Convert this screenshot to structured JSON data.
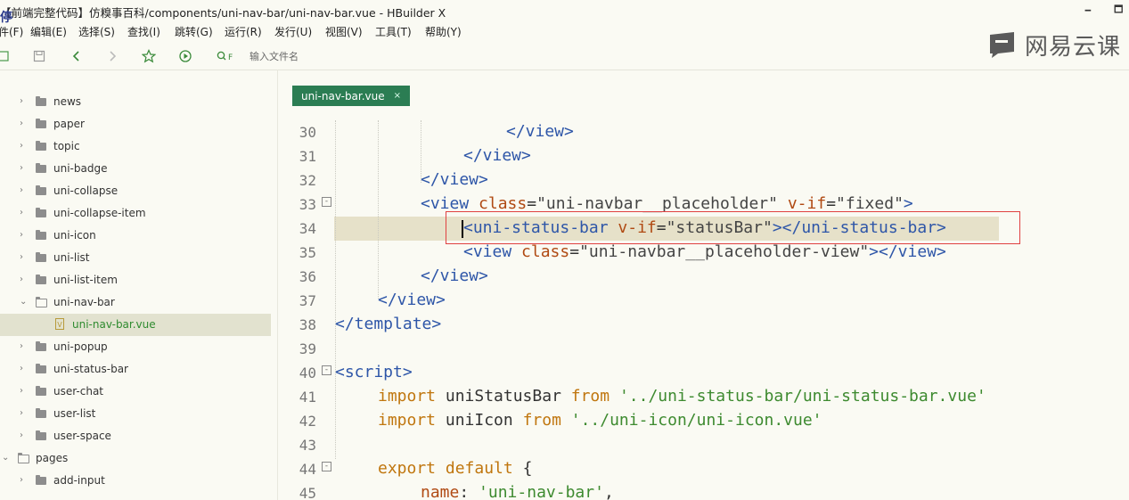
{
  "window": {
    "title": "【前端完整代码】仿糗事百科/components/uni-nav-bar/uni-nav-bar.vue - HBuilder X",
    "badge": "停",
    "minimize": "🗕",
    "maximize": "🗖"
  },
  "menu": [
    "件(F)",
    "编辑(E)",
    "选择(S)",
    "查找(I)",
    "跳转(G)",
    "运行(R)",
    "发行(U)",
    "视图(V)",
    "工具(T)",
    "帮助(Y)"
  ],
  "toolbar": {
    "search_placeholder": "输入文件名",
    "search_prefix": "Q F"
  },
  "watermark": {
    "text": "网易云课"
  },
  "sidebar": {
    "items": [
      {
        "label": "news",
        "type": "folder",
        "depth": 1,
        "expanded": false,
        "selected": false
      },
      {
        "label": "paper",
        "type": "folder",
        "depth": 1,
        "expanded": false,
        "selected": false
      },
      {
        "label": "topic",
        "type": "folder",
        "depth": 1,
        "expanded": false,
        "selected": false
      },
      {
        "label": "uni-badge",
        "type": "folder",
        "depth": 1,
        "expanded": false,
        "selected": false
      },
      {
        "label": "uni-collapse",
        "type": "folder",
        "depth": 1,
        "expanded": false,
        "selected": false
      },
      {
        "label": "uni-collapse-item",
        "type": "folder",
        "depth": 1,
        "expanded": false,
        "selected": false
      },
      {
        "label": "uni-icon",
        "type": "folder",
        "depth": 1,
        "expanded": false,
        "selected": false
      },
      {
        "label": "uni-list",
        "type": "folder",
        "depth": 1,
        "expanded": false,
        "selected": false
      },
      {
        "label": "uni-list-item",
        "type": "folder",
        "depth": 1,
        "expanded": false,
        "selected": false
      },
      {
        "label": "uni-nav-bar",
        "type": "folder",
        "depth": 1,
        "expanded": true,
        "selected": false
      },
      {
        "label": "uni-nav-bar.vue",
        "type": "vue",
        "depth": 2,
        "expanded": false,
        "selected": true
      },
      {
        "label": "uni-popup",
        "type": "folder",
        "depth": 1,
        "expanded": false,
        "selected": false
      },
      {
        "label": "uni-status-bar",
        "type": "folder",
        "depth": 1,
        "expanded": false,
        "selected": false
      },
      {
        "label": "user-chat",
        "type": "folder",
        "depth": 1,
        "expanded": false,
        "selected": false
      },
      {
        "label": "user-list",
        "type": "folder",
        "depth": 1,
        "expanded": false,
        "selected": false
      },
      {
        "label": "user-space",
        "type": "folder",
        "depth": 1,
        "expanded": false,
        "selected": false
      },
      {
        "label": "pages",
        "type": "folder",
        "depth": 0,
        "expanded": true,
        "selected": false
      },
      {
        "label": "add-input",
        "type": "folder",
        "depth": 1,
        "expanded": false,
        "selected": false
      }
    ]
  },
  "tab": {
    "label": "uni-nav-bar.vue",
    "close": "×"
  },
  "editor": {
    "lines": [
      {
        "num": "30",
        "fold": "",
        "indent": 8,
        "tokens": [
          [
            "tag",
            "</view>"
          ]
        ]
      },
      {
        "num": "31",
        "fold": "",
        "indent": 6,
        "tokens": [
          [
            "tag",
            "</view>"
          ]
        ]
      },
      {
        "num": "32",
        "fold": "",
        "indent": 4,
        "tokens": [
          [
            "tag",
            "</view>"
          ]
        ]
      },
      {
        "num": "33",
        "fold": "⊟",
        "indent": 4,
        "tokens": [
          [
            "tag",
            "<view "
          ],
          [
            "attr",
            "class"
          ],
          [
            "plain",
            "="
          ],
          [
            "str",
            "\"uni-navbar__placeholder\""
          ],
          [
            "plain",
            " "
          ],
          [
            "attr",
            "v-if"
          ],
          [
            "plain",
            "="
          ],
          [
            "str",
            "\"fixed\""
          ],
          [
            "tag",
            ">"
          ]
        ]
      },
      {
        "num": "34",
        "fold": "",
        "indent": 6,
        "current": true,
        "tokens": [
          [
            "tag",
            "<uni-status-bar "
          ],
          [
            "attr",
            "v-if"
          ],
          [
            "plain",
            "="
          ],
          [
            "str",
            "\"statusBar\""
          ],
          [
            "tag",
            "></uni-status-bar>"
          ]
        ]
      },
      {
        "num": "35",
        "fold": "",
        "indent": 6,
        "tokens": [
          [
            "tag",
            "<view "
          ],
          [
            "attr",
            "class"
          ],
          [
            "plain",
            "="
          ],
          [
            "str",
            "\"uni-navbar__placeholder-view\""
          ],
          [
            "tag",
            "></view>"
          ]
        ]
      },
      {
        "num": "36",
        "fold": "",
        "indent": 4,
        "tokens": [
          [
            "tag",
            "</view>"
          ]
        ]
      },
      {
        "num": "37",
        "fold": "",
        "indent": 2,
        "tokens": [
          [
            "tag",
            "</view>"
          ]
        ]
      },
      {
        "num": "38",
        "fold": "",
        "indent": 0,
        "tokens": [
          [
            "tag",
            "</template>"
          ]
        ]
      },
      {
        "num": "39",
        "fold": "",
        "indent": 0,
        "tokens": []
      },
      {
        "num": "40",
        "fold": "⊟",
        "indent": 0,
        "tokens": [
          [
            "tag",
            "<script>"
          ]
        ]
      },
      {
        "num": "41",
        "fold": "",
        "indent": 2,
        "tokens": [
          [
            "kw",
            "import "
          ],
          [
            "plain",
            "uniStatusBar "
          ],
          [
            "kw",
            "from "
          ],
          [
            "sstr",
            "'../uni-status-bar/uni-status-bar.vue'"
          ]
        ]
      },
      {
        "num": "42",
        "fold": "",
        "indent": 2,
        "tokens": [
          [
            "kw",
            "import "
          ],
          [
            "plain",
            "uniIcon "
          ],
          [
            "kw",
            "from "
          ],
          [
            "sstr",
            "'../uni-icon/uni-icon.vue'"
          ]
        ]
      },
      {
        "num": "43",
        "fold": "",
        "indent": 0,
        "tokens": []
      },
      {
        "num": "44",
        "fold": "⊟",
        "indent": 2,
        "tokens": [
          [
            "kw",
            "export default "
          ],
          [
            "plain",
            "{"
          ]
        ]
      },
      {
        "num": "45",
        "fold": "",
        "indent": 4,
        "tokens": [
          [
            "attr",
            "name"
          ],
          [
            "plain",
            ": "
          ],
          [
            "sstr",
            "'uni-nav-bar'"
          ],
          [
            "plain",
            ","
          ]
        ]
      }
    ]
  }
}
